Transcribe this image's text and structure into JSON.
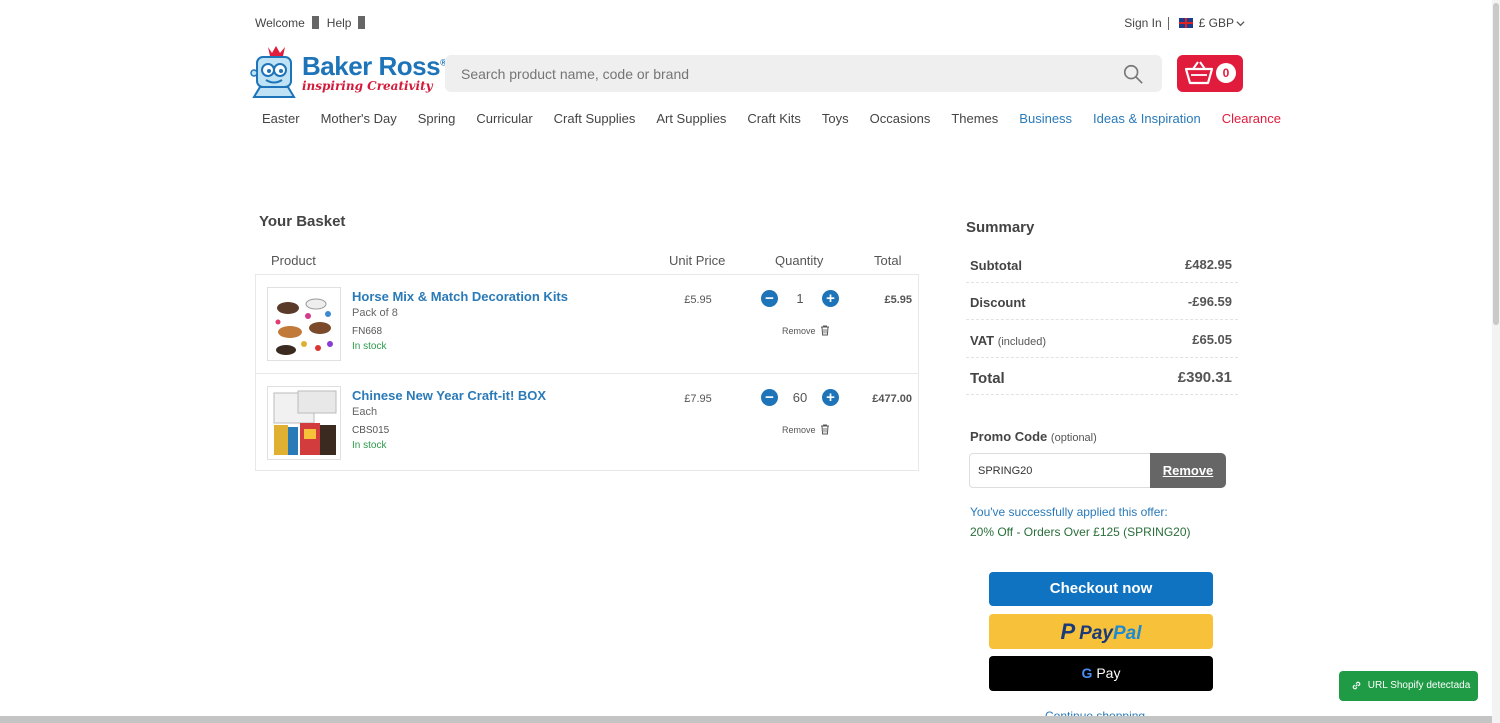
{
  "topbar": {
    "welcome": "Welcome",
    "help": "Help",
    "sign_in": "Sign In",
    "currency": "£ GBP"
  },
  "logo": {
    "brand": "Baker Ross",
    "registered": "®",
    "tagline": "inspiring Creativity"
  },
  "search": {
    "placeholder": "Search product name, code or brand"
  },
  "basket_button": {
    "count": "0"
  },
  "nav": {
    "items": [
      "Easter",
      "Mother's Day",
      "Spring",
      "Curricular",
      "Craft Supplies",
      "Art Supplies",
      "Craft Kits",
      "Toys",
      "Occasions",
      "Themes",
      "Business",
      "Ideas & Inspiration",
      "Clearance"
    ]
  },
  "basket": {
    "title": "Your Basket",
    "headers": {
      "product": "Product",
      "unit_price": "Unit Price",
      "quantity": "Quantity",
      "total": "Total"
    },
    "remove_label": "Remove",
    "items": [
      {
        "name": "Horse Mix & Match Decoration Kits",
        "variant": "Pack of 8",
        "code": "FN668",
        "stock": "In stock",
        "unit_price": "£5.95",
        "quantity": "1",
        "total": "£5.95"
      },
      {
        "name": "Chinese New Year Craft-it! BOX",
        "variant": "Each",
        "code": "CBS015",
        "stock": "In stock",
        "unit_price": "£7.95",
        "quantity": "60",
        "total": "£477.00"
      }
    ]
  },
  "summary": {
    "title": "Summary",
    "subtotal_label": "Subtotal",
    "subtotal": "£482.95",
    "discount_label": "Discount",
    "discount": "-£96.59",
    "vat_label": "VAT",
    "vat_note": "(included)",
    "vat": "£65.05",
    "total_label": "Total",
    "total": "£390.31"
  },
  "promo": {
    "label": "Promo Code",
    "optional": "(optional)",
    "value": "SPRING20",
    "remove_label": "Remove",
    "success_msg": "You've successfully applied this offer:",
    "offer": "20% Off - Orders Over £125 (SPRING20)"
  },
  "checkout": {
    "checkout_label": "Checkout now",
    "paypal_pay": "Pay",
    "paypal_pal": "Pal",
    "gpay_g": "G",
    "gpay_pay": "Pay",
    "continue_label": "Continue shopping"
  },
  "extension": {
    "shopify_label": "URL Shopify detectada"
  },
  "colors": {
    "brand_blue": "#1e74b8",
    "brand_red": "#e11b3c",
    "paypal_yellow": "#f7c23a",
    "success_green": "#2c9a4a"
  }
}
